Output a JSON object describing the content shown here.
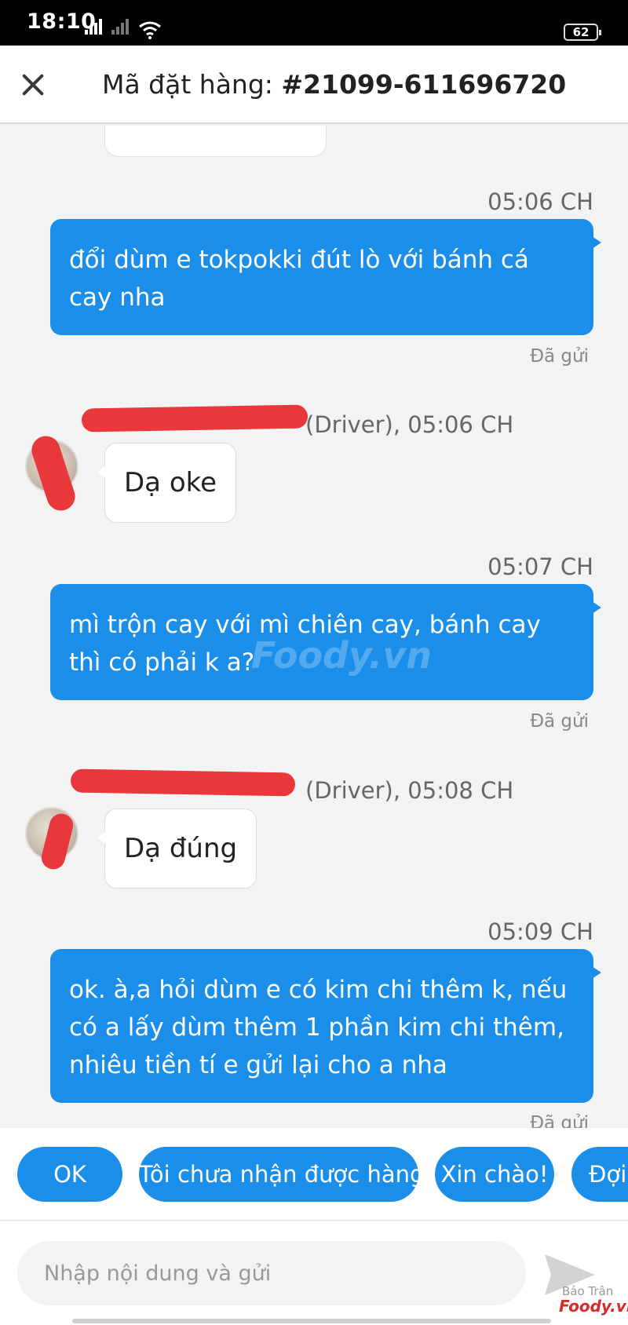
{
  "status_bar": {
    "time": "18:10",
    "battery": "62"
  },
  "header": {
    "title_prefix": "Mã đặt hàng: ",
    "order_id": "#21099-611696720"
  },
  "messages": [
    {
      "time": "05:06 CH",
      "text": "đổi dùm e tokpokki đút lò với bánh cá cay nha",
      "status": "Đã gửi"
    },
    {
      "sender_suffix": "(Driver), 05:06 CH",
      "text": "Dạ oke"
    },
    {
      "time": "05:07 CH",
      "text": "mì trộn cay với mì chiên cay, bánh cay thì có phải k a?",
      "status": "Đã gửi"
    },
    {
      "sender_suffix": "(Driver), 05:08 CH",
      "text": "Dạ đúng"
    },
    {
      "time": "05:09 CH",
      "text": "ok. à,a hỏi dùm e có kim chi thêm k, nếu có a lấy dùm thêm 1 phần kim chi thêm, nhiêu tiền tí e gửi lại cho a nha",
      "status": "Đã gửi"
    }
  ],
  "watermark": {
    "center": "Foody.vn",
    "author": "Bảo Trân",
    "brand": "Foody.vn"
  },
  "quick_replies": [
    "OK",
    "Tôi chưa nhận được hàng",
    "Xin chào!",
    "Đợi"
  ],
  "input": {
    "placeholder": "Nhập nội dung và gửi"
  },
  "colors": {
    "accent": "#1b8eea",
    "redaction": "#e8383b"
  }
}
